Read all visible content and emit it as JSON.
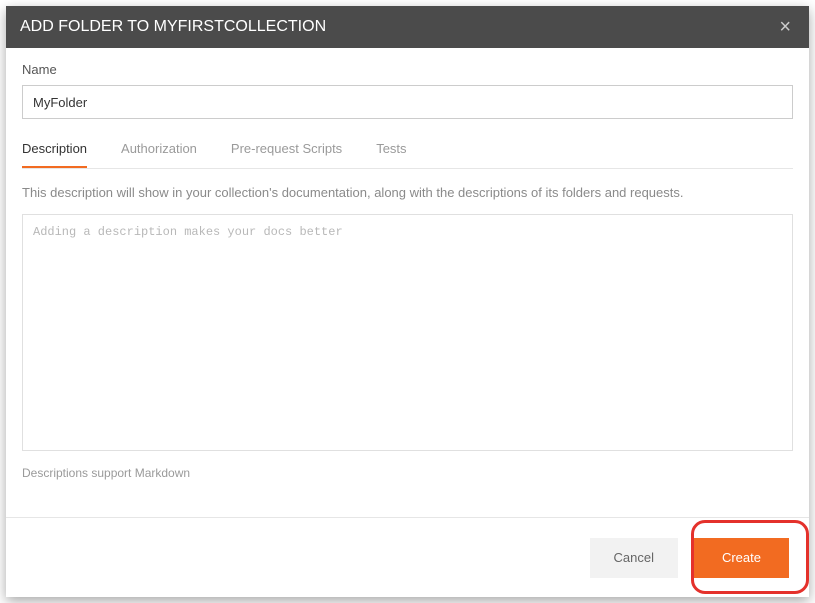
{
  "header": {
    "title": "ADD FOLDER TO MYFIRSTCOLLECTION"
  },
  "form": {
    "name_label": "Name",
    "name_value": "MyFolder"
  },
  "tabs": {
    "items": [
      {
        "label": "Description",
        "active": true
      },
      {
        "label": "Authorization",
        "active": false
      },
      {
        "label": "Pre-request Scripts",
        "active": false
      },
      {
        "label": "Tests",
        "active": false
      }
    ]
  },
  "description_panel": {
    "helper": "This description will show in your collection's documentation, along with the descriptions of its folders and requests.",
    "placeholder": "Adding a description makes your docs better",
    "markdown_note": "Descriptions support Markdown"
  },
  "footer": {
    "cancel": "Cancel",
    "create": "Create"
  },
  "colors": {
    "accent": "#f26b21",
    "header_bg": "#4b4b4b",
    "highlight": "#e4312b"
  }
}
